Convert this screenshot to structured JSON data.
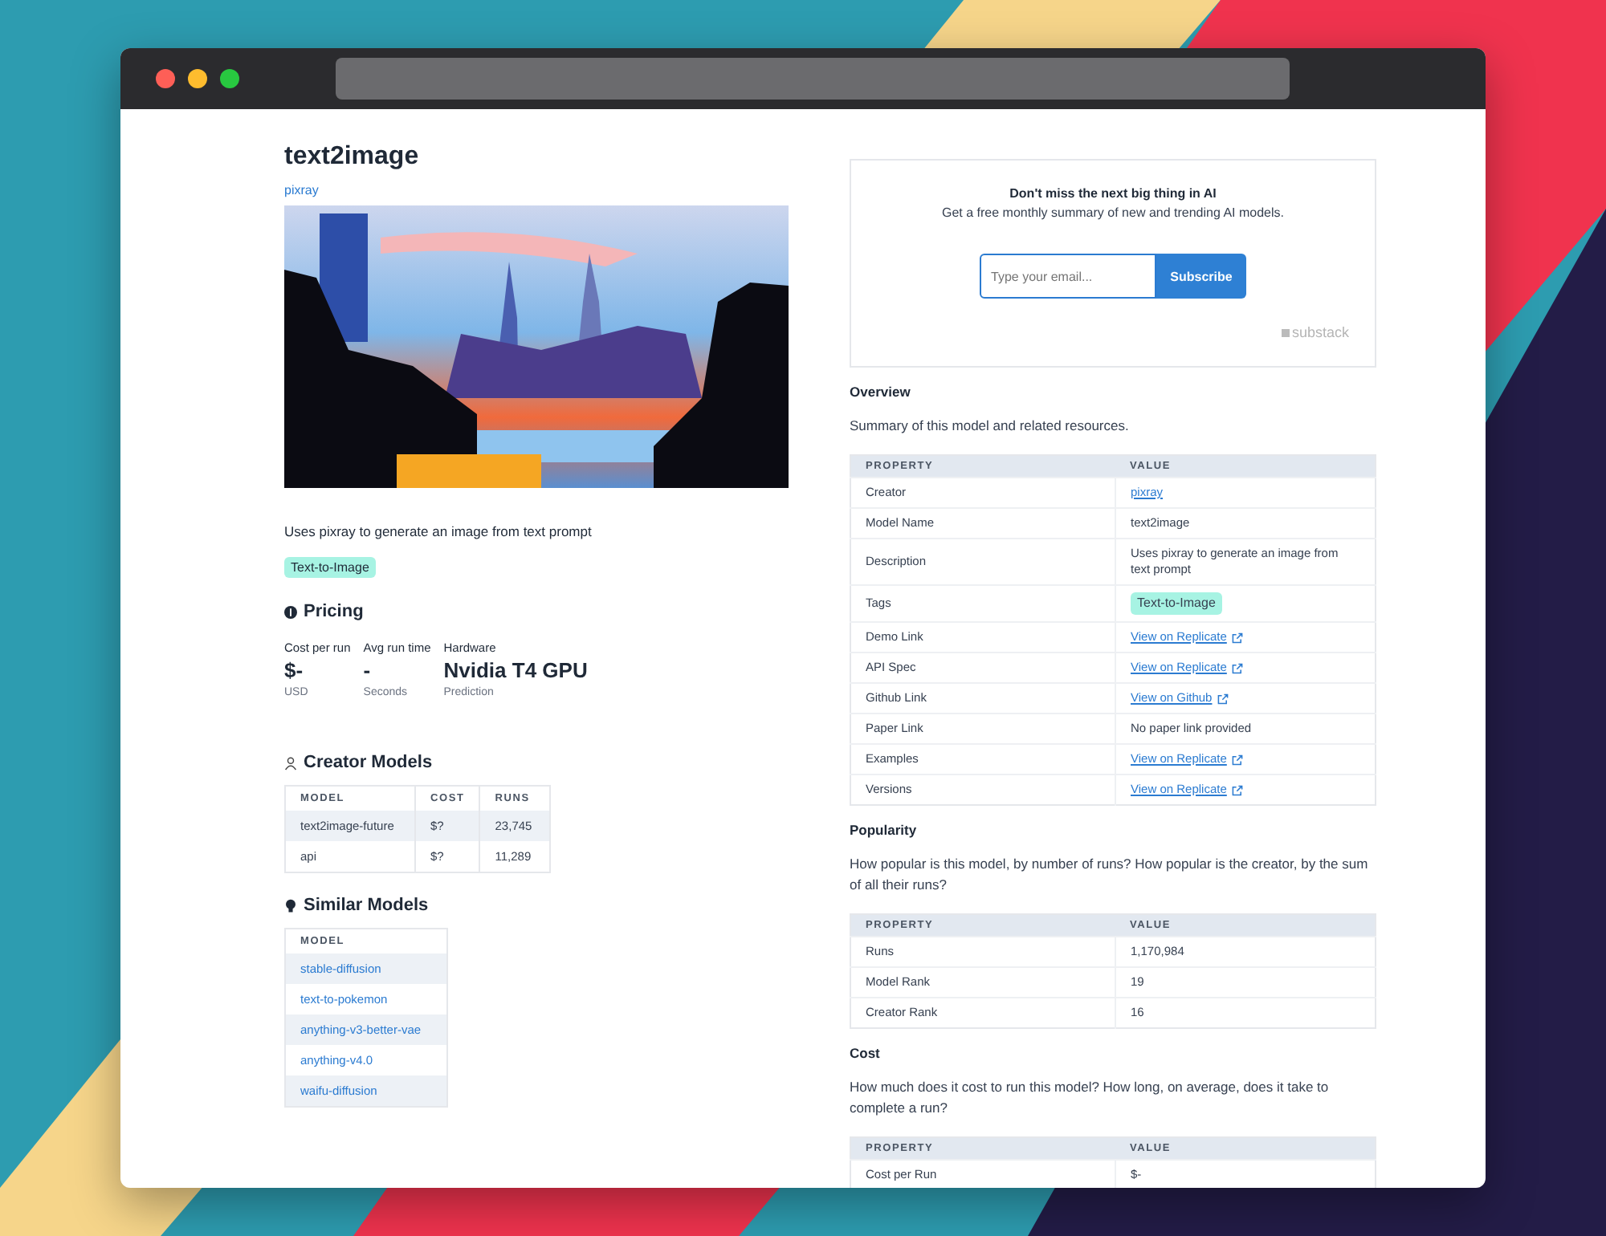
{
  "model": {
    "title": "text2image",
    "creator": "pixray",
    "description": "Uses pixray to generate an image from text prompt",
    "tags": [
      "Text-to-Image"
    ]
  },
  "pricing": {
    "title": "Pricing",
    "stats": [
      {
        "label": "Cost per run",
        "value": "$-",
        "unit": "USD"
      },
      {
        "label": "Avg run time",
        "value": "-",
        "unit": "Seconds"
      },
      {
        "label": "Hardware",
        "value": "Nvidia T4 GPU",
        "unit": "Prediction"
      }
    ]
  },
  "creator_models": {
    "title": "Creator Models",
    "columns": [
      "MODEL",
      "COST",
      "RUNS"
    ],
    "rows": [
      [
        "text2image-future",
        "$?",
        "23,745"
      ],
      [
        "api",
        "$?",
        "11,289"
      ]
    ]
  },
  "similar_models": {
    "title": "Similar Models",
    "columns": [
      "MODEL"
    ],
    "rows": [
      "stable-diffusion",
      "text-to-pokemon",
      "anything-v3-better-vae",
      "anything-v4.0",
      "waifu-diffusion"
    ]
  },
  "newsletter": {
    "heading": "Don't miss the next big thing in AI",
    "text": "Get a free monthly summary of new and trending AI models.",
    "placeholder": "Type your email...",
    "button": "Subscribe",
    "brand": "substack"
  },
  "sections": [
    {
      "title": "Overview",
      "text": "Summary of this model and related resources.",
      "columns": [
        "PROPERTY",
        "VALUE"
      ],
      "rows": [
        {
          "property": "Creator",
          "kind": "link",
          "value": "pixray"
        },
        {
          "property": "Model Name",
          "kind": "text",
          "value": "text2image"
        },
        {
          "property": "Description",
          "kind": "text",
          "value": "Uses pixray to generate an image from text prompt"
        },
        {
          "property": "Tags",
          "kind": "tag",
          "value": "Text-to-Image"
        },
        {
          "property": "Demo Link",
          "kind": "external",
          "value": "View on Replicate"
        },
        {
          "property": "API Spec",
          "kind": "external",
          "value": "View on Replicate"
        },
        {
          "property": "Github Link",
          "kind": "external",
          "value": "View on Github"
        },
        {
          "property": "Paper Link",
          "kind": "text",
          "value": "No paper link provided"
        },
        {
          "property": "Examples",
          "kind": "external",
          "value": "View on Replicate"
        },
        {
          "property": "Versions",
          "kind": "external",
          "value": "View on Replicate"
        }
      ]
    },
    {
      "title": "Popularity",
      "text": "How popular is this model, by number of runs? How popular is the creator, by the sum of all their runs?",
      "columns": [
        "PROPERTY",
        "VALUE"
      ],
      "rows": [
        {
          "property": "Runs",
          "kind": "text",
          "value": "1,170,984"
        },
        {
          "property": "Model Rank",
          "kind": "text",
          "value": "19"
        },
        {
          "property": "Creator Rank",
          "kind": "text",
          "value": "16"
        }
      ]
    },
    {
      "title": "Cost",
      "text": "How much does it cost to run this model? How long, on average, does it take to complete a run?",
      "columns": [
        "PROPERTY",
        "VALUE"
      ],
      "rows": [
        {
          "property": "Cost per Run",
          "kind": "text",
          "value": "$-"
        }
      ]
    }
  ]
}
